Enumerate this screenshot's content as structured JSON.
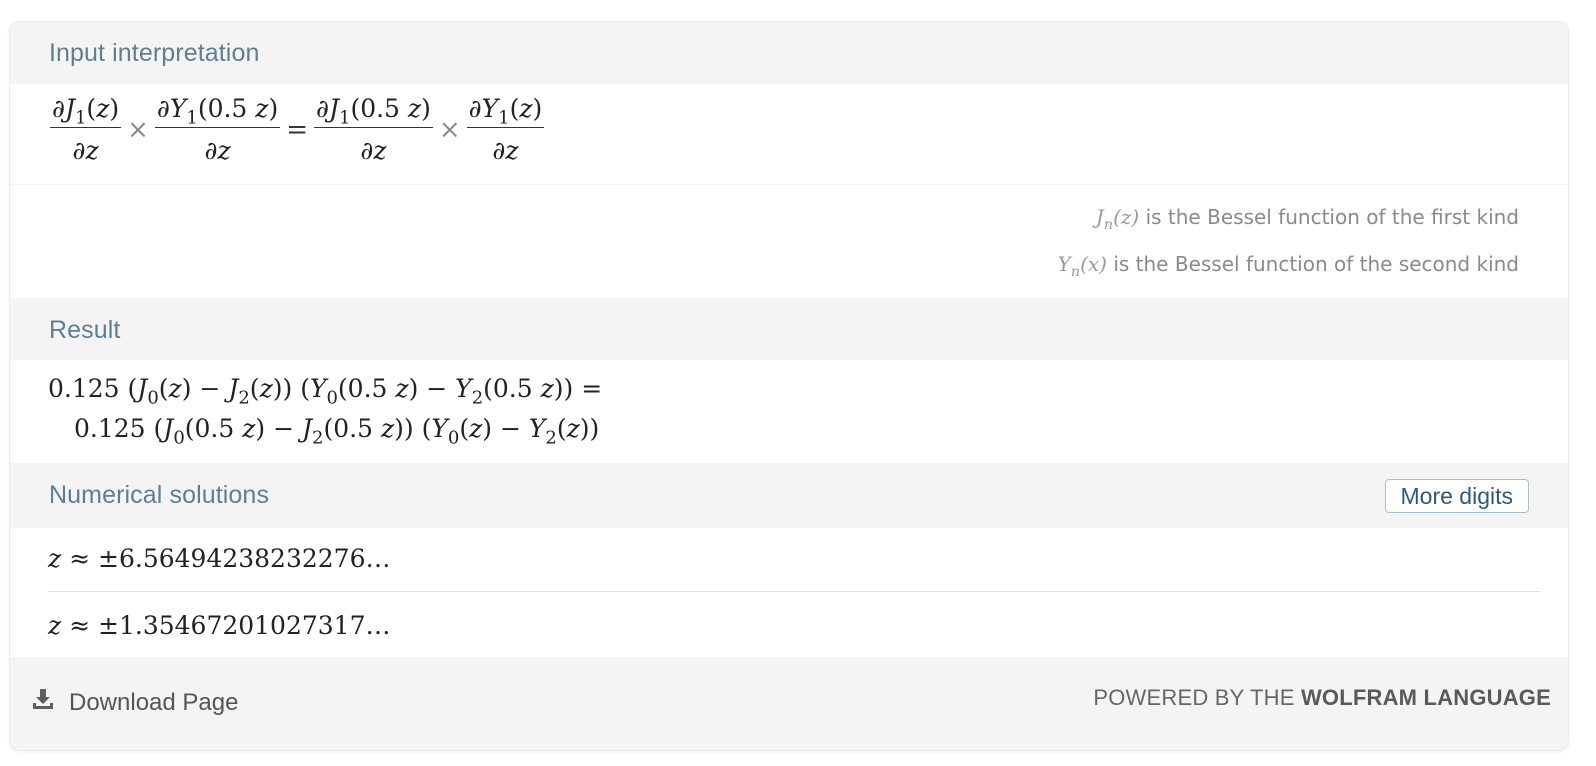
{
  "pods": {
    "input": {
      "title": "Input interpretation",
      "notes": [
        {
          "symbol": "J",
          "symbol_sub": "n",
          "symbol_arg": "(z)",
          "text": "is the Bessel function of the first kind"
        },
        {
          "symbol": "Y",
          "symbol_sub": "n",
          "symbol_arg": "(x)",
          "text": "is the Bessel function of the second kind"
        }
      ]
    },
    "result": {
      "title": "Result",
      "line1": "0.125 (J0(z) − J2(z)) (Y0(0.5 z) − Y2(0.5 z)) =",
      "line2": "0.125 (J0(0.5 z) − J2(0.5 z)) (Y0(z) − Y2(z))"
    },
    "solutions": {
      "title": "Numerical solutions",
      "more_digits_label": "More digits",
      "values": [
        "±6.56494238232276…",
        "±1.35467201027317…"
      ]
    }
  },
  "footer": {
    "download_label": "Download Page",
    "powered_prefix": "POWERED BY THE",
    "powered_brand": "WOLFRAM LANGUAGE"
  },
  "icons": {
    "download": "download-icon"
  }
}
